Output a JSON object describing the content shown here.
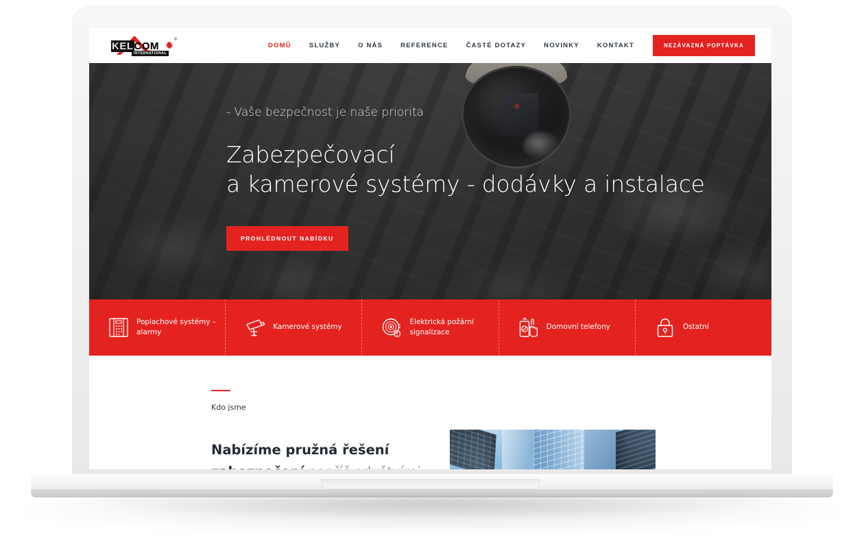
{
  "brand": {
    "logo_main": "KELCOM",
    "logo_kel": "KEL",
    "logo_com": "COM",
    "logo_sub": "INTERNATIONAL",
    "logo_registered": "®",
    "accent_color": "#e42320",
    "dark_color": "#2d3542"
  },
  "nav": {
    "items": [
      {
        "label": "DOMŮ",
        "active": true
      },
      {
        "label": "SLUŽBY",
        "active": false
      },
      {
        "label": "O NÁS",
        "active": false
      },
      {
        "label": "REFERENCE",
        "active": false
      },
      {
        "label": "ČASTÉ DOTAZY",
        "active": false
      },
      {
        "label": "NOVINKY",
        "active": false
      },
      {
        "label": "KONTAKT",
        "active": false
      }
    ],
    "cta_label": "NEZÁVAZNÁ POPTÁVKA"
  },
  "hero": {
    "kicker": "- Vaše bezpečnost je naše priorita",
    "title": "Zabezpečovací\na kamerové systémy - dodávky a instalace",
    "button_label": "PROHLÉDNOUT NABÍDKU",
    "background_subject": "dome-security-camera"
  },
  "services": {
    "items": [
      {
        "label": "Poplachové systémy – alarmy",
        "icon": "alarm-keypad-icon"
      },
      {
        "label": "Kamerové systémy",
        "icon": "cctv-camera-icon"
      },
      {
        "label": "Elektrická požární signalizace",
        "icon": "fire-alarm-siren-icon"
      },
      {
        "label": "Domovní telefony",
        "icon": "intercom-phone-icon"
      },
      {
        "label": "Ostatní",
        "icon": "padlock-icon"
      }
    ]
  },
  "about": {
    "eyebrow": "Kdo jsme",
    "heading_bold_1": "Nabízíme pružná řešení",
    "heading_bold_2": "zabezpečení",
    "heading_light": " napříč odvětvími pro",
    "photo_subject": "skyscrapers-looking-up"
  }
}
